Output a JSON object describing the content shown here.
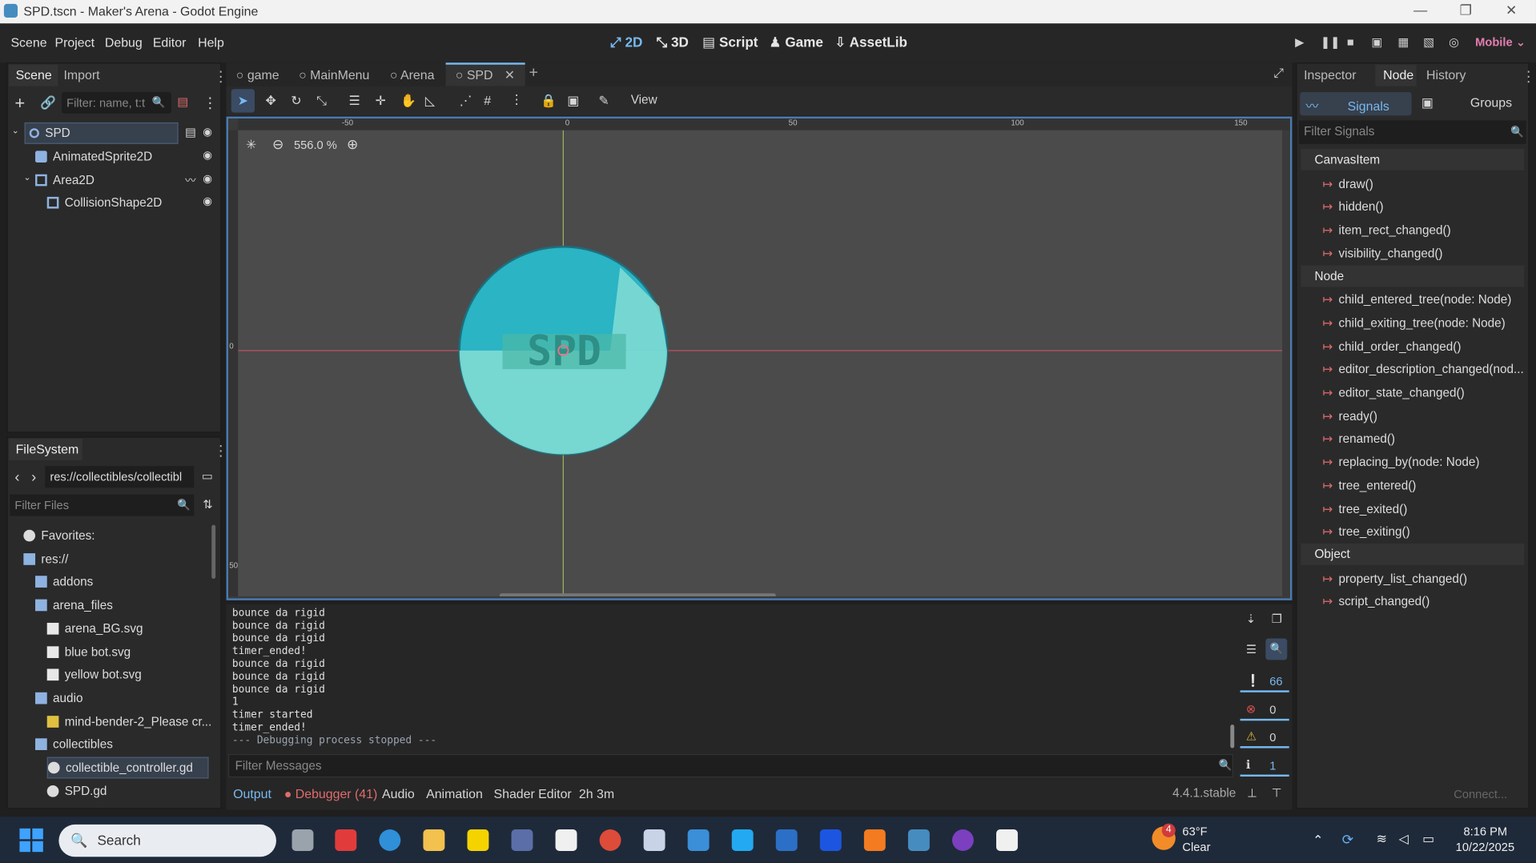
{
  "window": {
    "title": "SPD.tscn - Maker's Arena - Godot Engine"
  },
  "menu": [
    "Scene",
    "Project",
    "Debug",
    "Editor",
    "Help"
  ],
  "workspaces": [
    "2D",
    "3D",
    "Script",
    "Game",
    "AssetLib"
  ],
  "renderer": "Mobile",
  "scene_dock": {
    "tabs": [
      "Scene",
      "Import"
    ],
    "filter_placeholder": "Filter: name, t:t",
    "nodes": [
      {
        "name": "SPD",
        "icon": "node2d-icon"
      },
      {
        "name": "AnimatedSprite2D",
        "icon": "animated-sprite-icon"
      },
      {
        "name": "Area2D",
        "icon": "area2d-icon"
      },
      {
        "name": "CollisionShape2D",
        "icon": "collision-shape-icon"
      }
    ]
  },
  "filesystem": {
    "tab": "FileSystem",
    "path": "res://collectibles/collectibl",
    "filter_placeholder": "Filter Files",
    "items": [
      {
        "label": "Favorites:",
        "depth": 0,
        "icon": "star-icon"
      },
      {
        "label": "res://",
        "depth": 0,
        "icon": "folder-icon"
      },
      {
        "label": "addons",
        "depth": 1,
        "icon": "folder-icon"
      },
      {
        "label": "arena_files",
        "depth": 1,
        "icon": "folder-icon"
      },
      {
        "label": "arena_BG.svg",
        "depth": 2,
        "icon": "image-icon"
      },
      {
        "label": "blue bot.svg",
        "depth": 2,
        "icon": "image-icon"
      },
      {
        "label": "yellow bot.svg",
        "depth": 2,
        "icon": "image-icon"
      },
      {
        "label": "audio",
        "depth": 1,
        "icon": "folder-icon"
      },
      {
        "label": "mind-bender-2_Please cr...",
        "depth": 2,
        "icon": "audio-icon"
      },
      {
        "label": "collectibles",
        "depth": 1,
        "icon": "folder-icon"
      },
      {
        "label": "collectible_controller.gd",
        "depth": 2,
        "icon": "gear-icon"
      },
      {
        "label": "SPD.gd",
        "depth": 2,
        "icon": "gear-icon"
      }
    ]
  },
  "scene_tabs": [
    "game",
    "MainMenu",
    "Arena",
    "SPD"
  ],
  "toolbar": {
    "view_label": "View"
  },
  "viewport": {
    "zoom": "556.0 %",
    "ruler": [
      "-50",
      "0",
      "50",
      "100",
      "150"
    ],
    "ruler_v": [
      "0",
      "50"
    ],
    "sprite_text": "SPD"
  },
  "output": {
    "lines": [
      "bounce da rigid",
      "bounce da rigid",
      "bounce da rigid",
      "timer_ended!",
      "bounce da rigid",
      "bounce da rigid",
      "bounce da rigid",
      "1",
      "timer started",
      "timer_ended!",
      "--- Debugging process stopped ---"
    ],
    "filter_placeholder": "Filter Messages",
    "counts": {
      "messages": "66",
      "errors": "0",
      "warnings": "0",
      "info": "1"
    }
  },
  "bottom_tabs": [
    "Output",
    "Debugger (41)",
    "Audio",
    "Animation",
    "Shader Editor",
    "2h 3m"
  ],
  "version": "4.4.1.stable",
  "right_dock": {
    "tabs": [
      "Inspector",
      "Node",
      "History"
    ],
    "subtabs": [
      "Signals",
      "Groups"
    ],
    "filter_placeholder": "Filter Signals",
    "groups": [
      {
        "class": "CanvasItem",
        "signals": [
          "draw()",
          "hidden()",
          "item_rect_changed()",
          "visibility_changed()"
        ]
      },
      {
        "class": "Node",
        "signals": [
          "child_entered_tree(node: Node)",
          "child_exiting_tree(node: Node)",
          "child_order_changed()",
          "editor_description_changed(nod...",
          "editor_state_changed()",
          "ready()",
          "renamed()",
          "replacing_by(node: Node)",
          "tree_entered()",
          "tree_exited()",
          "tree_exiting()"
        ]
      },
      {
        "class": "Object",
        "signals": [
          "property_list_changed()",
          "script_changed()"
        ]
      }
    ],
    "connect_label": "Connect..."
  },
  "taskbar": {
    "search_placeholder": "Search",
    "weather_temp": "63°F",
    "weather_desc": "Clear",
    "weather_badge": "4",
    "time": "8:16 PM",
    "date": "10/22/2025"
  }
}
